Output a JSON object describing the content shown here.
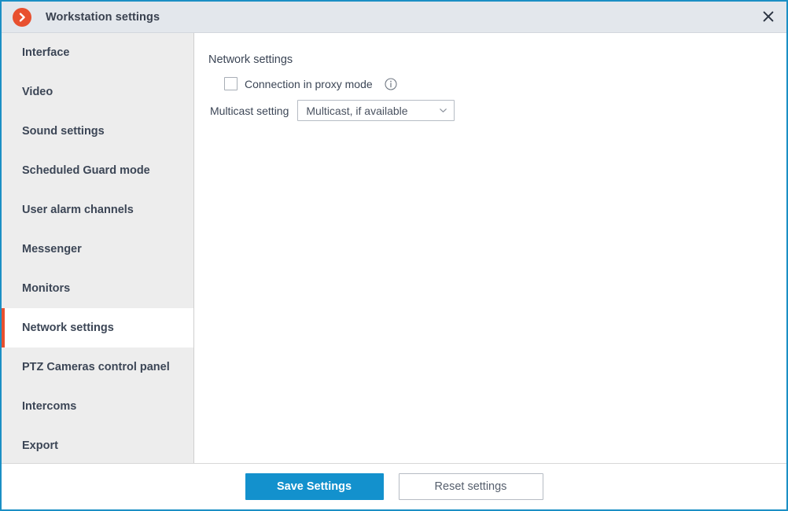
{
  "window": {
    "title": "Workstation settings",
    "app_icon": "chevron-right-circle-icon",
    "close_icon": "close-icon",
    "accent_color": "#e8502f",
    "border_color": "#1b8fc4",
    "titlebar_bg": "#e3e7ec"
  },
  "sidebar": {
    "items": [
      {
        "label": "Interface",
        "active": false
      },
      {
        "label": "Video",
        "active": false
      },
      {
        "label": "Sound settings",
        "active": false
      },
      {
        "label": "Scheduled Guard mode",
        "active": false
      },
      {
        "label": "User alarm channels",
        "active": false
      },
      {
        "label": "Messenger",
        "active": false
      },
      {
        "label": "Monitors",
        "active": false
      },
      {
        "label": "Network settings",
        "active": true
      },
      {
        "label": "PTZ Cameras control panel",
        "active": false
      },
      {
        "label": "Intercoms",
        "active": false
      },
      {
        "label": "Export",
        "active": false
      }
    ]
  },
  "content": {
    "section_title": "Network settings",
    "proxy": {
      "label": "Connection in proxy mode",
      "checked": false,
      "info_icon": "info-circle-icon"
    },
    "multicast": {
      "label": "Multicast setting",
      "value": "Multicast, if available",
      "chevron_icon": "chevron-down-icon",
      "options": [
        "Multicast, if available"
      ]
    }
  },
  "footer": {
    "save_label": "Save Settings",
    "reset_label": "Reset settings",
    "save_color": "#1391cd"
  }
}
